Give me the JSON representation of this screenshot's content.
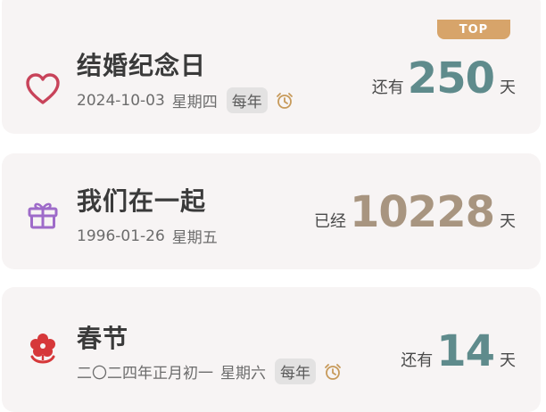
{
  "colors": {
    "card_bg": "#f7f4f4",
    "teal": "#5f8b8c",
    "tan": "#a89580",
    "heart": "#c8435a",
    "gift": "#9e6bc9",
    "flower": "#d6383a",
    "top_badge": "#d7a46a"
  },
  "events": [
    {
      "icon": "heart-icon",
      "title": "结婚纪念日",
      "date": "2024-10-03",
      "weekday": "星期四",
      "badge": "每年",
      "has_alarm": true,
      "prefix": "还有",
      "count": "250",
      "unit": "天",
      "top_label": "TOP"
    },
    {
      "icon": "gift-icon",
      "title": "我们在一起",
      "date": "1996-01-26",
      "weekday": "星期五",
      "prefix": "已经",
      "count": "10228",
      "unit": "天"
    },
    {
      "icon": "flower-icon",
      "title": "春节",
      "date": "二〇二四年正月初一",
      "weekday": "星期六",
      "badge": "每年",
      "has_alarm": true,
      "prefix": "还有",
      "count": "14",
      "unit": "天"
    }
  ]
}
